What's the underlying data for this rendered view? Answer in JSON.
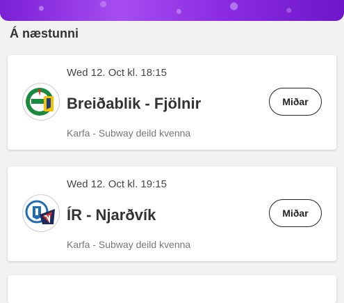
{
  "section": {
    "title": "Á næstunni"
  },
  "games": [
    {
      "datetime": "Wed 12. Oct kl. 18:15",
      "teams": "Breiðablik - Fjölnir",
      "league": "Karfa - Subway deild kvenna",
      "ticket_label": "Miðar",
      "logo_icon": "breidablik-fjolnir-logo-icon"
    },
    {
      "datetime": "Wed 12. Oct kl. 19:15",
      "teams": "ÍR - Njarðvík",
      "league": "Karfa - Subway deild kvenna",
      "ticket_label": "Miðar",
      "logo_icon": "ir-njardvik-logo-icon"
    }
  ],
  "colors": {
    "banner": "#8a2be2",
    "background": "#f2f2f2"
  }
}
